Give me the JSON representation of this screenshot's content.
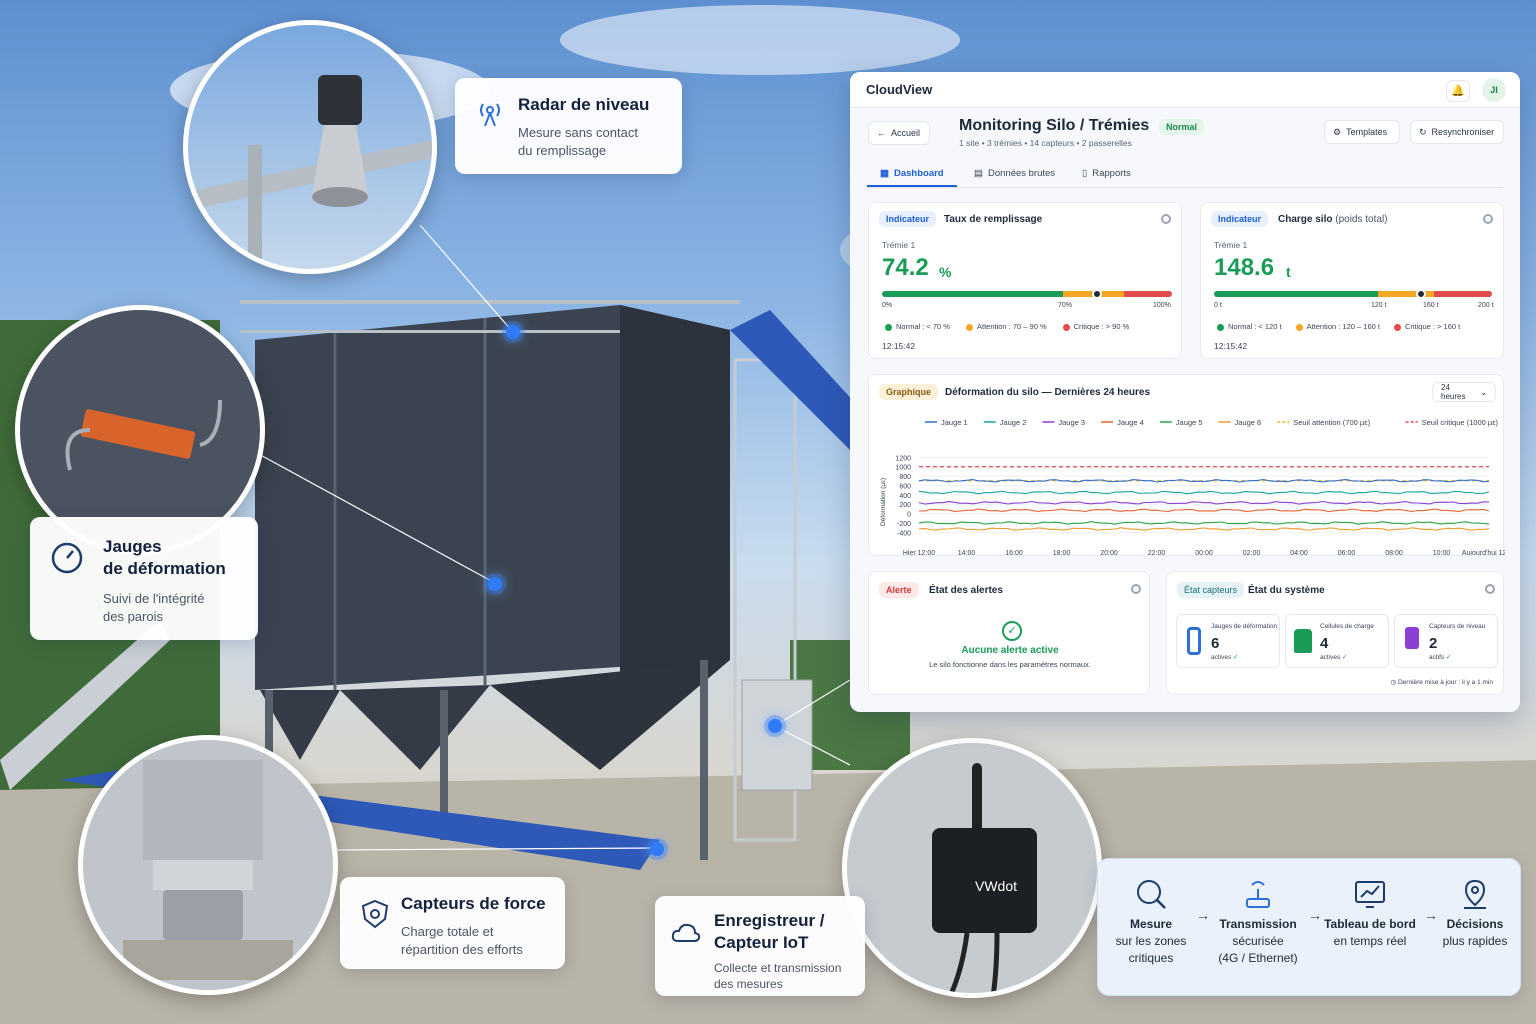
{
  "callouts": {
    "radar": {
      "title": "Radar de niveau",
      "desc1": "Mesure sans contact",
      "desc2": "du remplissage"
    },
    "gauges": {
      "title1": "Jauges",
      "title2": "de déformation",
      "desc1": "Suivi de l'intégrité",
      "desc2": "des parois"
    },
    "force": {
      "title": "Capteurs de force",
      "desc1": "Charge totale et",
      "desc2": "répartition des efforts"
    },
    "logger": {
      "title1": "Enregistreur /",
      "title2": "Capteur IoT",
      "desc1": "Collecte et transmission",
      "desc2": "des mesures"
    }
  },
  "device_label": "VWdot",
  "flow": [
    {
      "title": "Mesure",
      "line1": "sur les zones",
      "line2": "critiques",
      "icon": "gauge-search-icon"
    },
    {
      "title": "Transmission",
      "line1": "sécurisée",
      "line2": "(4G / Ethernet)",
      "icon": "antenna-icon"
    },
    {
      "title": "Tableau de bord",
      "line1": "en temps réel",
      "line2": "",
      "icon": "chart-monitor-icon"
    },
    {
      "title": "Décisions",
      "line1": "plus rapides",
      "line2": "",
      "icon": "location-pin-icon"
    }
  ],
  "dashboard": {
    "brand": "CloudView",
    "avatar": "JI",
    "back": "Accueil",
    "title": "Monitoring Silo / Trémies",
    "status": "Normal",
    "subtitle": "1 site • 3 trémies • 14 capteurs • 2 passerelles",
    "btn_templates": "Templates",
    "btn_resync": "Resynchroniser",
    "tabs": [
      "Dashboard",
      "Données brutes",
      "Rapports"
    ],
    "fill": {
      "tag": "Indicateur",
      "title": "Taux de remplissage",
      "sub": "Trémie 1",
      "value": "74.2",
      "unit": "%",
      "level": 0.742,
      "ticks": [
        "0%",
        "70%",
        "100%"
      ],
      "legend": [
        "Normal : < 70 %",
        "Attention : 70 – 90 %",
        "Critique : > 90 %"
      ],
      "time": "12:15:42"
    },
    "load": {
      "tag": "Indicateur",
      "title": "Charge silo",
      "title_suffix": "(poids total)",
      "sub": "Trémie 1",
      "value": "148.6",
      "unit": "t",
      "level": 0.743,
      "ticks": [
        "0 t",
        "120 t",
        "160 t",
        "200 t"
      ],
      "legend": [
        "Normal : < 120 t",
        "Attention : 120 – 160 t",
        "Critique : > 160 t"
      ],
      "time": "12:15:42"
    },
    "chart": {
      "tag": "Graphique",
      "title": "Déformation du silo — Dernières 24 heures",
      "range": "24 heures",
      "ylabel": "Déformation (µε)"
    },
    "alerts": {
      "tag": "Alerte",
      "title": "État des alertes",
      "msg": "Aucune alerte active",
      "sub": "Le silo fonctionne dans les paramètres normaux."
    },
    "system": {
      "tag": "État capteurs",
      "title": "État du système",
      "sensors": [
        {
          "label": "Jauges de déformation",
          "count": "6",
          "status": "actives"
        },
        {
          "label": "Cellules de charge",
          "count": "4",
          "status": "actives"
        },
        {
          "label": "Capteurs de niveau",
          "count": "2",
          "status": "actifs"
        }
      ],
      "updated": "Dernière mise à jour : il y a 1 min"
    }
  },
  "chart_data": {
    "type": "line",
    "title": "Déformation du silo — Dernières 24 heures",
    "ylabel": "Déformation (µε)",
    "x": [
      "Hier 12:00",
      "14:00",
      "16:00",
      "18:00",
      "20:00",
      "22:00",
      "00:00",
      "02:00",
      "04:00",
      "06:00",
      "08:00",
      "10:00",
      "Aujourd'hui 12:00"
    ],
    "yticks": [
      1200,
      1000,
      800,
      600,
      400,
      200,
      0,
      -200,
      -400
    ],
    "ylim": [
      -500,
      1250
    ],
    "series": [
      {
        "name": "Jauge 1",
        "color": "#2f6fd6",
        "level": 700
      },
      {
        "name": "Jauge 2",
        "color": "#16a79a",
        "level": 450
      },
      {
        "name": "Jauge 3",
        "color": "#8b3fd6",
        "level": 230
      },
      {
        "name": "Jauge 4",
        "color": "#e8622c",
        "level": 70
      },
      {
        "name": "Jauge 5",
        "color": "#28a745",
        "level": -200
      },
      {
        "name": "Jauge 6",
        "color": "#f29a2e",
        "level": -330
      }
    ],
    "thresholds": [
      {
        "name": "Seuil attention (700 µε)",
        "value": 700,
        "color": "#f0b429"
      },
      {
        "name": "Seuil critique (1000 µε)",
        "value": 1000,
        "color": "#e24b4b"
      }
    ]
  },
  "colors": {
    "green": "#1a9b57",
    "orange": "#f5a623",
    "red": "#e24b4b",
    "accent": "#2f7cf6"
  }
}
